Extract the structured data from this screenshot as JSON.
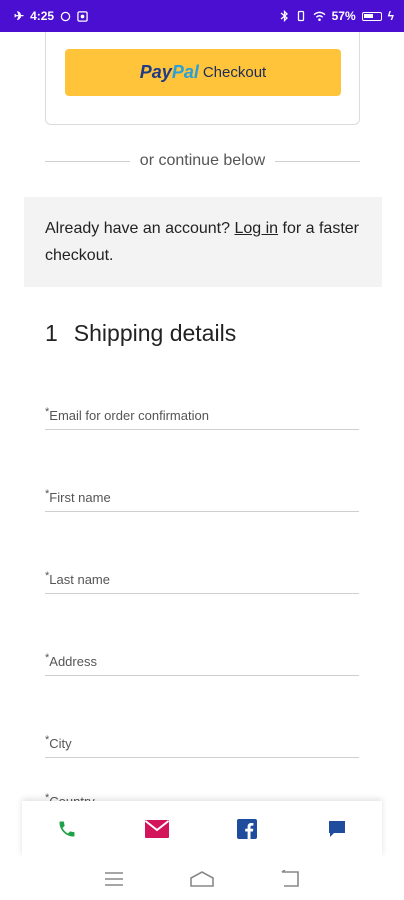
{
  "status_bar": {
    "time": "4:25",
    "battery": "57%",
    "bg_color": "#4a0fd0"
  },
  "paypal": {
    "pay": "Pay",
    "pal": "Pal",
    "checkout": "Checkout",
    "button_color": "#ffc43a"
  },
  "divider": {
    "text": "or continue below"
  },
  "account": {
    "prefix": "Already have an account? ",
    "link": "Log in",
    "suffix": " for a faster checkout."
  },
  "section": {
    "number": "1",
    "title": "Shipping details"
  },
  "form": {
    "required_mark": "*",
    "fields": [
      {
        "label": "Email for order confirmation"
      },
      {
        "label": "First name"
      },
      {
        "label": "Last name"
      },
      {
        "label": "Address"
      },
      {
        "label": "City"
      },
      {
        "label": "Country"
      }
    ]
  },
  "action_bar": {
    "icons": [
      "phone-icon",
      "mail-icon",
      "facebook-icon",
      "chat-icon"
    ],
    "colors": {
      "phone": "#1fa34a",
      "mail": "#d4145a",
      "facebook": "#1f4c9c",
      "chat": "#1f4c9c"
    }
  },
  "nav_bar": {
    "icons": [
      "menu-icon",
      "home-icon",
      "back-icon"
    ]
  }
}
